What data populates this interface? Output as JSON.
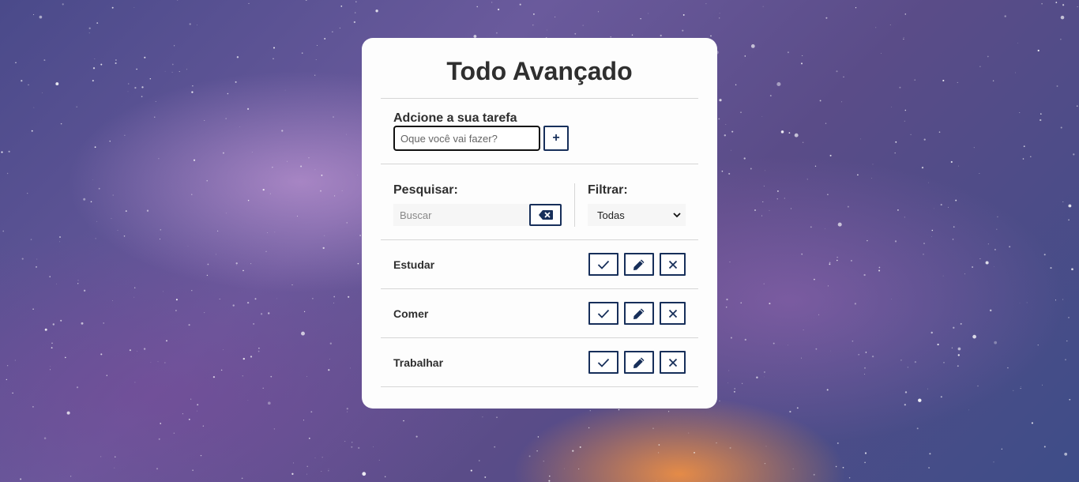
{
  "app": {
    "title": "Todo Avançado"
  },
  "add_form": {
    "label": "Adcione a sua tarefa",
    "input_placeholder": "Oque você vai fazer?",
    "input_value": "",
    "add_button_label": "+"
  },
  "search": {
    "label": "Pesquisar:",
    "placeholder": "Buscar",
    "value": "",
    "clear_icon": "backspace-icon"
  },
  "filter": {
    "label": "Filtrar:",
    "selected": "Todas"
  },
  "todos": [
    {
      "text": "Estudar"
    },
    {
      "text": "Comer"
    },
    {
      "text": "Trabalhar"
    }
  ],
  "colors": {
    "accent": "#172f5a",
    "card_bg": "#fdfdfd",
    "text": "#2f2f2f"
  }
}
